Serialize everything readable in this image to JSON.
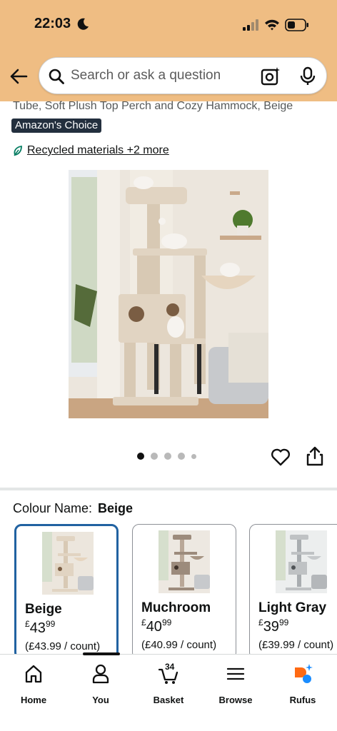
{
  "status": {
    "time": "22:03"
  },
  "search": {
    "placeholder": "Search or ask a question"
  },
  "product": {
    "title_fragment": "Tube, Soft Plush Top Perch and Cozy Hammock, Beige",
    "badge": "Amazon's Choice",
    "sustainability_link": "Recycled materials +2 more",
    "image_count": 5,
    "active_image_index": 0
  },
  "colour": {
    "label": "Colour Name:",
    "selected": "Beige",
    "options": [
      {
        "name": "Beige",
        "price_whole": "43",
        "price_fraction": "99",
        "currency": "£",
        "unit_price": "(£43.99 / count)",
        "selected": true
      },
      {
        "name": "Muchroom",
        "price_whole": "40",
        "price_fraction": "99",
        "currency": "£",
        "unit_price": "(£40.99 / count)",
        "selected": false
      },
      {
        "name": "Light Gray",
        "price_whole": "39",
        "price_fraction": "99",
        "currency": "£",
        "unit_price": "(£39.99 / count)",
        "selected": false
      }
    ]
  },
  "tabbar": {
    "home": "Home",
    "you": "You",
    "basket": "Basket",
    "basket_count": "34",
    "browse": "Browse",
    "rufus": "Rufus"
  },
  "colors": {
    "header_bg": "#efbd83",
    "badge_bg": "#232f3e",
    "selected_border": "#2162a1",
    "rufus_orange": "#ff6a13",
    "rufus_blue": "#1a8cff"
  }
}
